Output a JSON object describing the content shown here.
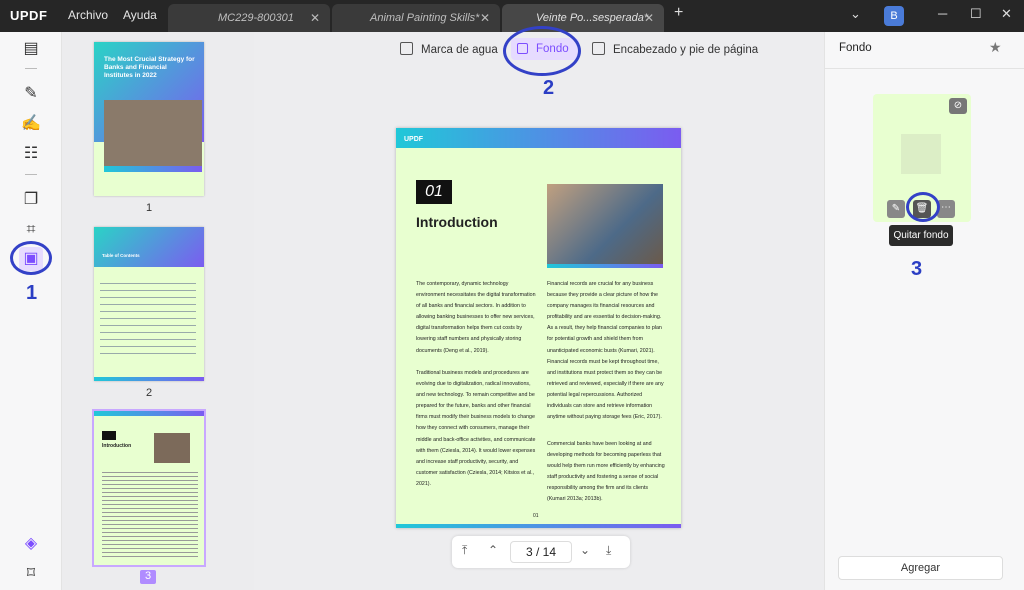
{
  "app": {
    "logo": "UPDF"
  },
  "menu": {
    "archivo": "Archivo",
    "ayuda": "Ayuda"
  },
  "tabs": [
    {
      "label": "MC229-800301"
    },
    {
      "label": "Animal Painting Skills*"
    },
    {
      "label": "Veinte Po...sesperada*"
    }
  ],
  "user": {
    "initial": "B"
  },
  "toolbar": {
    "watermark": "Marca de agua",
    "background": "Fondo",
    "header_footer": "Encabezado y pie de página"
  },
  "thumbnails": [
    {
      "num": "1",
      "title": "The Most Crucial Strategy for Banks and Financial Institutes in 2022"
    },
    {
      "num": "2",
      "title": "Table of Contents"
    },
    {
      "num": "3",
      "title": "Introduction"
    }
  ],
  "document": {
    "logo": "UPDF",
    "chapter": "01",
    "heading": "Introduction",
    "col_left_p1": "The contemporary, dynamic technology environment necessitates the digital transformation of all banks and financial sectors. In addition to allowing banking businesses to offer new services, digital transformation helps them cut costs by lowering staff numbers and physically storing documents (Deng et al., 2019).",
    "col_left_p2": "Traditional business models and procedures are evolving due to digitalization, radical innovations, and new technology. To remain competitive and be prepared for the future, banks and other financial firms must modify their business models to change how they connect with consumers, manage their middle and back-office activities, and communicate with them (Cziesla, 2014). It would lower expenses and increase staff productivity, security, and customer satisfaction (Cziesla, 2014; Kitsios et al., 2021).",
    "col_right_p1": "Financial records are crucial for any business because they provide a clear picture of how the company manages its financial resources and profitability and are essential to decision-making. As a result, they help financial companies to plan for potential growth and shield them from unanticipated economic busts (Kumari, 2021). Financial records must be kept throughout time, and institutions must protect them so they can be retrieved and reviewed, especially if there are any potential legal repercussions. Authorized individuals can store and retrieve information anytime without paying storage fees (Eric, 2017).",
    "col_right_p2": "Commercial banks have been looking at and developing methods for becoming paperless that would help them run more efficiently by enhancing staff productivity and fostering a sense of social responsibility among the firm and its clients (Kumari 2013a; 2013b).",
    "page_label": "01"
  },
  "pagination": {
    "current": "3",
    "separator": "/",
    "total": "14"
  },
  "right_panel": {
    "title": "Fondo",
    "tooltip": "Quitar fondo",
    "add_button": "Agregar"
  },
  "annotations": {
    "one": "1",
    "two": "2",
    "three": "3"
  },
  "colors": {
    "accent": "#7c4dff",
    "annotation": "#3341c7",
    "page_bg": "#e8ffd0"
  }
}
